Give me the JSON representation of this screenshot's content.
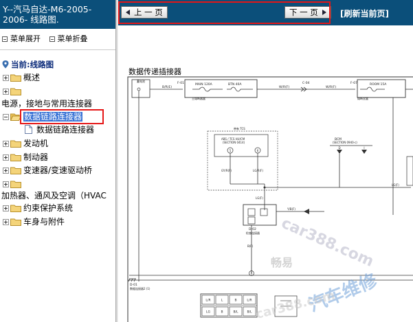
{
  "sidebar": {
    "title_line1": "Y--汽马自达-M6-2005-",
    "title_line2": "2006- 线路图.",
    "expand_label": "菜单展开",
    "collapse_label": "菜单折叠",
    "current_label": "当前:线路图",
    "tree": [
      {
        "label": "概述"
      },
      {
        "label": ""
      },
      {
        "label": "电源，接地与常用连接器"
      },
      {
        "label": "数据链路连接器",
        "selected": true
      },
      {
        "label": "数据链路连接器"
      },
      {
        "label": "发动机"
      },
      {
        "label": "制动器"
      },
      {
        "label": "变速器/变速驱动桥"
      },
      {
        "label": ""
      },
      {
        "label": "加热器、通风及空调（HVAC"
      },
      {
        "label": "约束保护系统"
      },
      {
        "label": "车身与附件"
      }
    ]
  },
  "nav": {
    "prev_label": "上 一 页",
    "next_label": "下 一 页",
    "refresh_label": "[刷新当前页]"
  },
  "diagram": {
    "title": "数据传递插接器",
    "labels": {
      "relay_box": "蓄电池",
      "f01": "F-01",
      "main_fuse": "MAIN 120A",
      "btn_fuse": "BTN 40A",
      "main_fuse_box": "主熔断器盒",
      "br_f": "B/R(E)",
      "wr_f": "W/R(F)",
      "c04": "C-04",
      "f07": "F-07",
      "room_fuse": "ROOM 15A",
      "fuse_box2": "熔断丝盒",
      "with_tcs": "带有 TCS",
      "abs_tcs": "ABS / TCS HU/CM",
      "section_0414": "(SECTION 0414)",
      "pin5": "5",
      "pin6": "6",
      "gyr": "GY/R(F)",
      "lgr": "LG/R(F)",
      "bcm": "BCM",
      "section_0940": "(SECTION 0940-c)",
      "pin_d": "D",
      "pin_i": "I",
      "lg_f": "LG(F)",
      "lg_f2": "LG(F)",
      "yb_f": "Y/B(F)",
      "d02": "D-02",
      "dlc": "检查连接器",
      "b_f": "B(F)",
      "ground": "G",
      "d01": "D-01",
      "dlc2": "数据连接器2 (1)",
      "connector_pins": [
        "L/R",
        "L",
        "B",
        "L/R",
        "LG",
        "B",
        "B/L",
        "B/L"
      ]
    },
    "watermarks": [
      "car388.com",
      "畅易",
      "汽车维修",
      "car388.com"
    ]
  },
  "colors": {
    "title_bg": "#0b4f7a",
    "highlight": "#e51616",
    "selected_bg": "#3b74d6"
  }
}
